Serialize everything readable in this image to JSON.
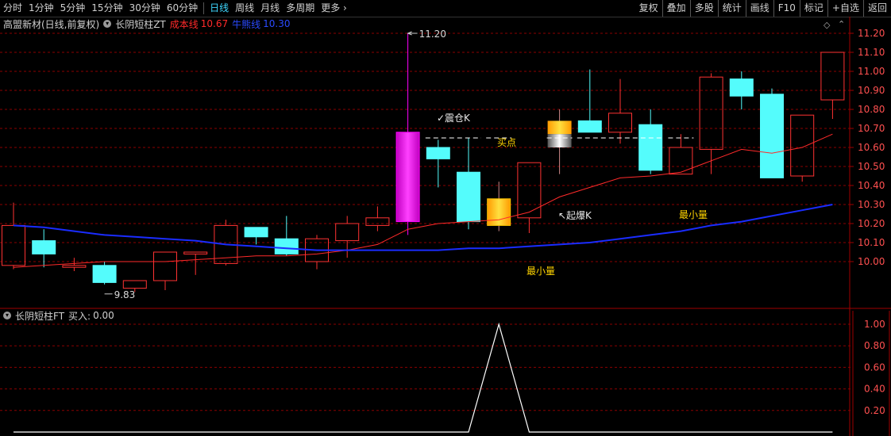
{
  "toolbar": {
    "left_items": [
      "分时",
      "1分钟",
      "5分钟",
      "15分钟",
      "30分钟",
      "60分钟",
      "日线",
      "周线",
      "月线",
      "多周期",
      "更多"
    ],
    "active": "日线",
    "more_arrow": "›",
    "right_items": [
      "复权",
      "叠加",
      "多股",
      "统计",
      "画线",
      "F10",
      "标记",
      "+自选",
      "返回"
    ]
  },
  "main_legend": {
    "stock": "高盟新材(日线,前复权)",
    "indicator": "长阴短柱ZT",
    "cost_label": "成本线",
    "cost_value": "10.67",
    "bull_label": "牛熊线",
    "bull_value": "10.30"
  },
  "sub_legend": {
    "indicator": "长阴短柱FT",
    "buy_label": "买入:",
    "buy_value": "0.00"
  },
  "annotations": {
    "high_marker": "11.20",
    "low_marker": "9.83",
    "zhencang": "✓震仓K",
    "maidian": "买点",
    "qibao": "↖起爆K",
    "min_vol_1": "最小量",
    "min_vol_2": "最小量"
  },
  "colors": {
    "up": "#ff3232",
    "down": "#54fcfc",
    "magenta": "#ff00ff",
    "gold": "#ffc800",
    "cost_line": "#ff2a2a",
    "bull_line": "#1a2cff",
    "axis_text": "#ff5050",
    "grid": "#8b0000"
  },
  "chart_data": [
    {
      "type": "candlestick",
      "y_ticks": [
        10.0,
        10.1,
        10.2,
        10.3,
        10.4,
        10.5,
        10.6,
        10.7,
        10.8,
        10.9,
        11.0,
        11.1,
        11.2
      ],
      "ylim": [
        9.83,
        11.22
      ],
      "candles": [
        {
          "o": 10.19,
          "h": 10.31,
          "l": 9.96,
          "c": 9.98,
          "kind": "up"
        },
        {
          "o": 10.11,
          "h": 10.17,
          "l": 9.97,
          "c": 10.04,
          "kind": "down"
        },
        {
          "o": 9.97,
          "h": 10.02,
          "l": 9.95,
          "c": 9.98,
          "kind": "up"
        },
        {
          "o": 9.98,
          "h": 10.0,
          "l": 9.88,
          "c": 9.89,
          "kind": "down"
        },
        {
          "o": 9.86,
          "h": 9.9,
          "l": 9.84,
          "c": 9.9,
          "kind": "up"
        },
        {
          "o": 9.9,
          "h": 10.05,
          "l": 9.85,
          "c": 10.05,
          "kind": "up"
        },
        {
          "o": 10.04,
          "h": 10.05,
          "l": 9.93,
          "c": 10.05,
          "kind": "up"
        },
        {
          "o": 9.99,
          "h": 10.22,
          "l": 9.98,
          "c": 10.19,
          "kind": "up"
        },
        {
          "o": 10.18,
          "h": 10.18,
          "l": 10.09,
          "c": 10.13,
          "kind": "down"
        },
        {
          "o": 10.12,
          "h": 10.24,
          "l": 10.03,
          "c": 10.04,
          "kind": "down"
        },
        {
          "o": 10.0,
          "h": 10.14,
          "l": 9.96,
          "c": 10.12,
          "kind": "up"
        },
        {
          "o": 10.11,
          "h": 10.24,
          "l": 10.02,
          "c": 10.2,
          "kind": "up"
        },
        {
          "o": 10.19,
          "h": 10.29,
          "l": 10.16,
          "c": 10.23,
          "kind": "up"
        },
        {
          "o": 10.21,
          "h": 11.2,
          "l": 10.14,
          "c": 10.68,
          "kind": "magenta"
        },
        {
          "o": 10.6,
          "h": 10.64,
          "l": 10.39,
          "c": 10.54,
          "kind": "down"
        },
        {
          "o": 10.47,
          "h": 10.65,
          "l": 10.17,
          "c": 10.21,
          "kind": "down"
        },
        {
          "o": 10.19,
          "h": 10.42,
          "l": 10.16,
          "c": 10.33,
          "kind": "gold"
        },
        {
          "o": 10.23,
          "h": 10.52,
          "l": 10.15,
          "c": 10.52,
          "kind": "up"
        },
        {
          "o": 10.6,
          "h": 10.8,
          "l": 10.46,
          "c": 10.74,
          "kind": "gold-gray"
        },
        {
          "o": 10.74,
          "h": 11.01,
          "l": 10.68,
          "c": 10.68,
          "kind": "down"
        },
        {
          "o": 10.68,
          "h": 10.96,
          "l": 10.62,
          "c": 10.78,
          "kind": "up"
        },
        {
          "o": 10.72,
          "h": 10.8,
          "l": 10.46,
          "c": 10.48,
          "kind": "down"
        },
        {
          "o": 10.46,
          "h": 10.67,
          "l": 10.46,
          "c": 10.6,
          "kind": "up"
        },
        {
          "o": 10.59,
          "h": 10.99,
          "l": 10.46,
          "c": 10.97,
          "kind": "up"
        },
        {
          "o": 10.96,
          "h": 11.0,
          "l": 10.8,
          "c": 10.87,
          "kind": "down"
        },
        {
          "o": 10.88,
          "h": 10.91,
          "l": 10.44,
          "c": 10.44,
          "kind": "down"
        },
        {
          "o": 10.45,
          "h": 10.77,
          "l": 10.42,
          "c": 10.77,
          "kind": "up"
        },
        {
          "o": 10.85,
          "h": 11.1,
          "l": 10.75,
          "c": 11.1,
          "kind": "up"
        }
      ],
      "cost_line": [
        9.97,
        9.98,
        9.99,
        10.0,
        10.0,
        10.0,
        10.01,
        10.02,
        10.03,
        10.03,
        10.04,
        10.06,
        10.09,
        10.17,
        10.2,
        10.21,
        10.22,
        10.26,
        10.34,
        10.39,
        10.44,
        10.45,
        10.47,
        10.53,
        10.59,
        10.57,
        10.6,
        10.67
      ],
      "bull_line": [
        10.19,
        10.18,
        10.16,
        10.14,
        10.13,
        10.12,
        10.11,
        10.09,
        10.08,
        10.07,
        10.06,
        10.06,
        10.06,
        10.06,
        10.06,
        10.07,
        10.07,
        10.08,
        10.09,
        10.1,
        10.12,
        10.14,
        10.16,
        10.19,
        10.21,
        10.24,
        10.27,
        10.3
      ],
      "buy_level": 10.65
    },
    {
      "type": "line",
      "y_ticks": [
        0.2,
        0.4,
        0.6,
        0.8,
        1.0
      ],
      "ylim": [
        0,
        1.0
      ],
      "values": [
        0,
        0,
        0,
        0,
        0,
        0,
        0,
        0,
        0,
        0,
        0,
        0,
        0,
        0,
        0,
        0,
        1,
        0,
        0,
        0,
        0,
        0,
        0,
        0,
        0,
        0,
        0,
        0
      ]
    }
  ]
}
